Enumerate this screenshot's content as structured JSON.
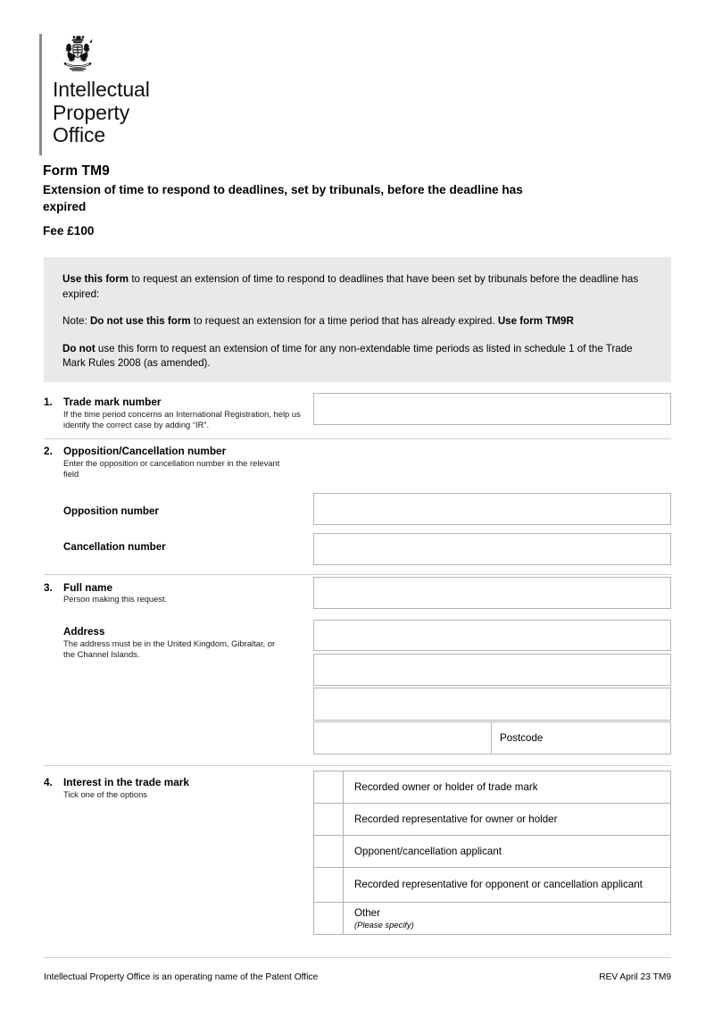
{
  "header": {
    "crest_icon": "royal-coat-of-arms-icon",
    "organisation_line1": "Intellectual",
    "organisation_line2": "Property",
    "organisation_line3": "Office"
  },
  "title": {
    "form_code": "Form TM9",
    "subtitle": "Extension of time to respond to deadlines, set by tribunals, before the deadline has expired",
    "fee": "Fee £100"
  },
  "notice": {
    "p1_bold": "Use this form",
    "p1_rest": " to request an extension of time to respond to deadlines that have been set by tribunals before the deadline has expired:",
    "p2_prefix": "Note: ",
    "p2_bold1": "Do not use this form",
    "p2_mid": " to request an extension for a time period that has already expired. ",
    "p2_bold2": "Use form TM9R",
    "p3_bold": "Do not",
    "p3_rest": " use this form to request an extension of time for any non-extendable time periods as listed in schedule 1 of the Trade Mark Rules 2008 (as amended)."
  },
  "sections": {
    "s1": {
      "number": "1.",
      "title": "Trade mark number",
      "help": "If the time period concerns an International Registration, help us identify the correct case by adding “IR”.",
      "field_value": ""
    },
    "s2": {
      "number": "2.",
      "title": "Opposition/Cancellation number",
      "help": "Enter the opposition or cancellation number in the relevant field",
      "opposition_label": "Opposition number",
      "opposition_value": "",
      "cancellation_label": "Cancellation number",
      "cancellation_value": ""
    },
    "s3": {
      "number": "3.",
      "title": "Full name",
      "help": "Person making this request.",
      "name_value": "",
      "address_label": "Address",
      "address_help": "The address must be in the United Kingdom, Gibraltar, or the Channel Islands.",
      "address_line1": "",
      "address_line2": "",
      "address_line3": "",
      "address_line4": "",
      "postcode_label": "Postcode",
      "postcode_value": ""
    },
    "s4": {
      "number": "4.",
      "title": "Interest in the trade mark",
      "help": "Tick one of the options",
      "options": [
        {
          "label": "Recorded owner or holder of trade mark",
          "sub": "",
          "checked": false
        },
        {
          "label": "Recorded representative for owner or holder",
          "sub": "",
          "checked": false
        },
        {
          "label": "Opponent/cancellation applicant",
          "sub": "",
          "checked": false
        },
        {
          "label": "Recorded representative for opponent or cancellation applicant",
          "sub": "",
          "checked": false
        },
        {
          "label": "Other",
          "sub": "(Please specify)",
          "checked": false
        }
      ]
    }
  },
  "footer": {
    "left": "Intellectual Property Office is an operating name of the Patent Office",
    "right": "REV April 23 TM9"
  },
  "colors": {
    "notice_bg": "#e9e9e9",
    "rule": "#cfcfcf",
    "field_border": "#b5b5b5"
  }
}
